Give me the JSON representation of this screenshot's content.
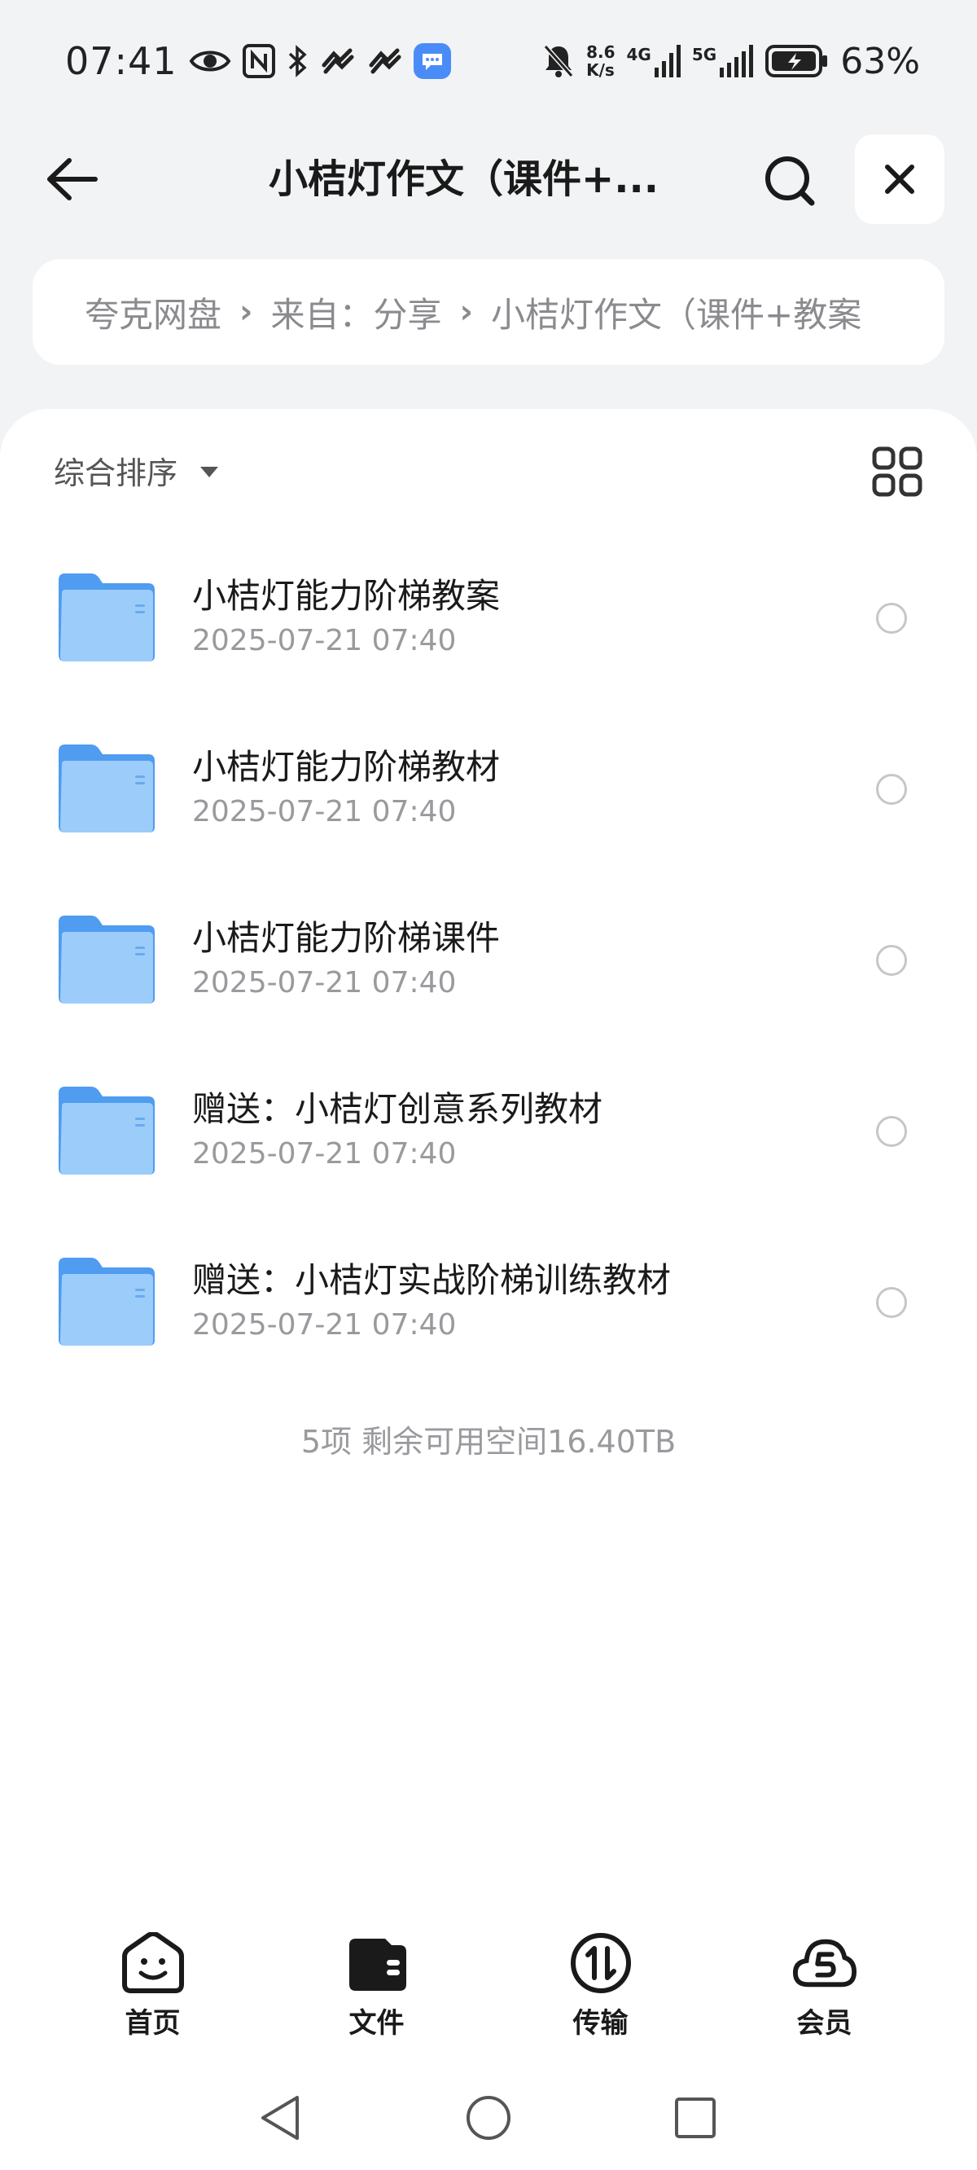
{
  "status_bar": {
    "time": "07:41",
    "speed_value": "8.6",
    "speed_unit": "K/s",
    "net1": "4G",
    "net2": "5G",
    "battery": "63%"
  },
  "header": {
    "title": "小桔灯作文（课件+..."
  },
  "breadcrumb": {
    "items": [
      "夸克网盘",
      "来自：分享",
      "小桔灯作文（课件+教案"
    ]
  },
  "toolbar": {
    "sort_label": "综合排序"
  },
  "files": [
    {
      "name": "小桔灯能力阶梯教案",
      "date": "2025-07-21 07:40"
    },
    {
      "name": "小桔灯能力阶梯教材",
      "date": "2025-07-21 07:40"
    },
    {
      "name": "小桔灯能力阶梯课件",
      "date": "2025-07-21 07:40"
    },
    {
      "name": "赠送：小桔灯创意系列教材",
      "date": "2025-07-21 07:40"
    },
    {
      "name": "赠送：小桔灯实战阶梯训练教材",
      "date": "2025-07-21 07:40"
    }
  ],
  "summary": "5项 剩余可用空间16.40TB",
  "bottom_nav": [
    {
      "label": "首页",
      "icon": "smile-home-icon"
    },
    {
      "label": "文件",
      "icon": "wallet-files-icon"
    },
    {
      "label": "传输",
      "icon": "transfer-icon"
    },
    {
      "label": "会员",
      "icon": "cloud-member-icon"
    }
  ],
  "colors": {
    "background": "#f2f3f5",
    "folder": "#6cb4f5",
    "text_primary": "#1a1a1a",
    "text_secondary": "#9a9a9e"
  }
}
